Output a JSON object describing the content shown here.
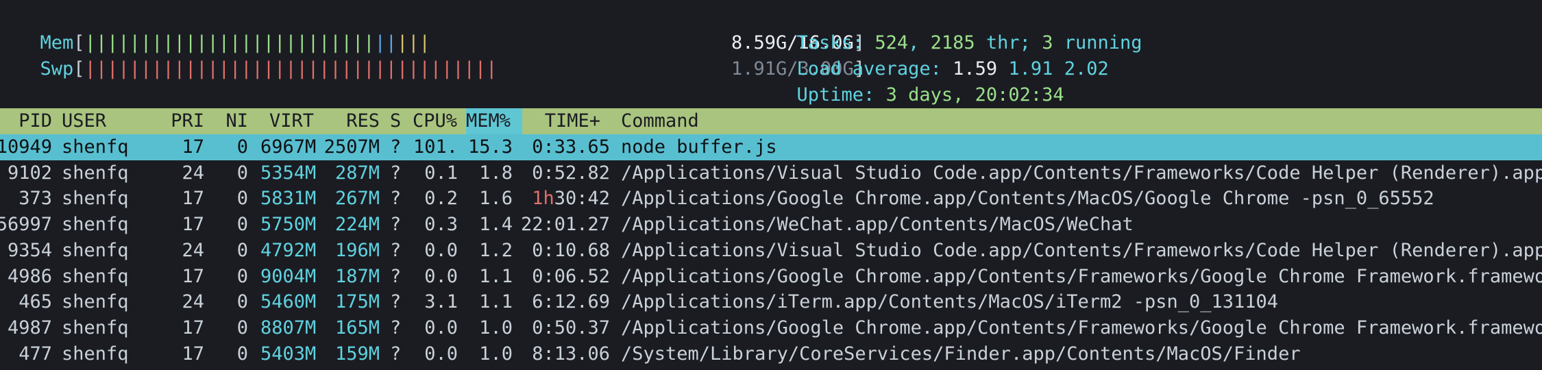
{
  "meters": {
    "mem": {
      "label": "Mem",
      "open": "[",
      "value": "8.59G/16.0G",
      "close": "]",
      "fraction": 0.537
    },
    "swp": {
      "label": "Swp",
      "open": "[",
      "value": "1.91G/3.00G",
      "close": "]",
      "fraction": 0.637
    }
  },
  "summary": {
    "tasks": {
      "label": "Tasks: ",
      "count": "524",
      "sep": ", ",
      "thr": "2185",
      "thr_label": " thr; ",
      "running": "3",
      "running_label": " running"
    },
    "load": {
      "label": "Load average: ",
      "l1": "1.59",
      "l5": "1.91",
      "l15": "2.02"
    },
    "uptime": {
      "label": "Uptime: ",
      "value": "3 days, 20:02:34"
    }
  },
  "table": {
    "columns": [
      "PID",
      "USER",
      "PRI",
      "NI",
      "VIRT",
      "RES",
      "S",
      "CPU%",
      "MEM%",
      "TIME+",
      "Command"
    ],
    "sort_column": "MEM%",
    "rows": [
      {
        "pid": "10949",
        "user": "shenfq",
        "pri": "17",
        "ni": "0",
        "virt": "6967M",
        "res": "2507M",
        "s": "?",
        "cpu": "101.",
        "mem": "15.3",
        "time_h": "",
        "time": "0:33.65",
        "cmd": "node buffer.js",
        "selected": true
      },
      {
        "pid": "9102",
        "user": "shenfq",
        "pri": "24",
        "ni": "0",
        "virt": "5354M",
        "res": "287M",
        "s": "?",
        "cpu": "0.1",
        "mem": "1.8",
        "time_h": "",
        "time": "0:52.82",
        "cmd": "/Applications/Visual Studio Code.app/Contents/Frameworks/Code Helper (Renderer).app/"
      },
      {
        "pid": "373",
        "user": "shenfq",
        "pri": "17",
        "ni": "0",
        "virt": "5831M",
        "res": "267M",
        "s": "?",
        "cpu": "0.2",
        "mem": "1.6",
        "time_h": "1h",
        "time": "30:42",
        "cmd": "/Applications/Google Chrome.app/Contents/MacOS/Google Chrome -psn_0_65552"
      },
      {
        "pid": "56997",
        "user": "shenfq",
        "pri": "17",
        "ni": "0",
        "virt": "5750M",
        "res": "224M",
        "s": "?",
        "cpu": "0.3",
        "mem": "1.4",
        "time_h": "",
        "time": "22:01.27",
        "cmd": "/Applications/WeChat.app/Contents/MacOS/WeChat"
      },
      {
        "pid": "9354",
        "user": "shenfq",
        "pri": "24",
        "ni": "0",
        "virt": "4792M",
        "res": "196M",
        "s": "?",
        "cpu": "0.0",
        "mem": "1.2",
        "time_h": "",
        "time": "0:10.68",
        "cmd": "/Applications/Visual Studio Code.app/Contents/Frameworks/Code Helper (Renderer).app/"
      },
      {
        "pid": "4986",
        "user": "shenfq",
        "pri": "17",
        "ni": "0",
        "virt": "9004M",
        "res": "187M",
        "s": "?",
        "cpu": "0.0",
        "mem": "1.1",
        "time_h": "",
        "time": "0:06.52",
        "cmd": "/Applications/Google Chrome.app/Contents/Frameworks/Google Chrome Framework.framewor"
      },
      {
        "pid": "465",
        "user": "shenfq",
        "pri": "24",
        "ni": "0",
        "virt": "5460M",
        "res": "175M",
        "s": "?",
        "cpu": "3.1",
        "mem": "1.1",
        "time_h": "",
        "time": "6:12.69",
        "cmd": "/Applications/iTerm.app/Contents/MacOS/iTerm2 -psn_0_131104"
      },
      {
        "pid": "4987",
        "user": "shenfq",
        "pri": "17",
        "ni": "0",
        "virt": "8807M",
        "res": "165M",
        "s": "?",
        "cpu": "0.0",
        "mem": "1.0",
        "time_h": "",
        "time": "0:50.37",
        "cmd": "/Applications/Google Chrome.app/Contents/Frameworks/Google Chrome Framework.framewor"
      },
      {
        "pid": "477",
        "user": "shenfq",
        "pri": "17",
        "ni": "0",
        "virt": "5403M",
        "res": "159M",
        "s": "?",
        "cpu": "0.0",
        "mem": "1.0",
        "time_h": "",
        "time": "8:13.06",
        "cmd": "/System/Library/CoreServices/Finder.app/Contents/MacOS/Finder"
      }
    ]
  },
  "colors": {
    "background": "#1b1c22",
    "header_bg": "#a9c47f",
    "sort_col_bg": "#5fc7d4",
    "selected_row_bg": "#58bfd0",
    "label_cyan": "#5fd3e0",
    "mem_bar_green": "#9be08a",
    "mem_bar_blue": "#5aa6e8",
    "mem_bar_yellow": "#d9c36a",
    "swap_bar_red": "#e0706a"
  }
}
